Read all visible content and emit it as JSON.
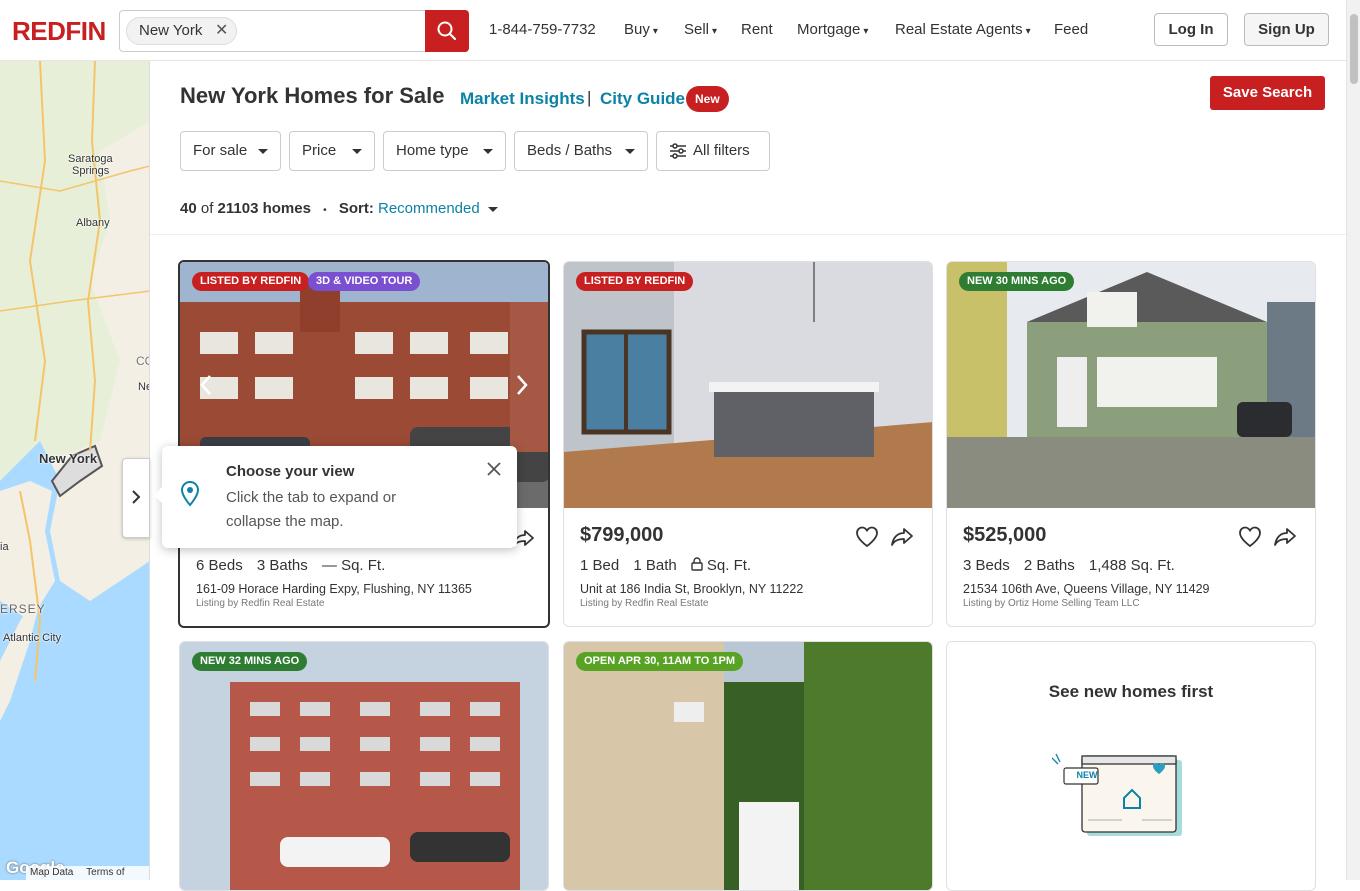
{
  "header": {
    "logo": "REDFIN",
    "search_chip": "New York",
    "phone": "1-844-759-7732",
    "nav": [
      {
        "label": "Buy",
        "caret": "▾"
      },
      {
        "label": "Sell",
        "caret": "▾"
      },
      {
        "label": "Rent",
        "caret": ""
      },
      {
        "label": "Mortgage",
        "caret": "▾"
      },
      {
        "label": "Real Estate Agents",
        "caret": "▾"
      },
      {
        "label": "Feed",
        "caret": ""
      }
    ],
    "login": "Log In",
    "signup": "Sign Up"
  },
  "map": {
    "labels": [
      "Saratoga",
      "Springs",
      "Albany",
      "New York",
      "ERSEY",
      "Atlantic City",
      "Ne",
      "ia",
      "CO"
    ],
    "google": "Google",
    "attribution_data": "Map Data",
    "attribution_terms": "Terms of Use"
  },
  "popover": {
    "title": "Choose your view",
    "body": "Click the tab to expand or collapse the map."
  },
  "page": {
    "title": "New York Homes for Sale",
    "market_insights": "Market Insights",
    "separator": "|",
    "city_guide": "City Guide",
    "new_badge": "New",
    "save_search": "Save Search"
  },
  "filters": [
    "For sale",
    "Price",
    "Home type",
    "Beds / Baths",
    "All filters"
  ],
  "results": {
    "shown": "40",
    "of": "of",
    "total": "21103 homes",
    "dot": "•",
    "sort_label": "Sort:",
    "sort_value": "Recommended"
  },
  "listings": [
    {
      "tags": [
        "LISTED BY REDFIN",
        "3D & VIDEO TOUR"
      ],
      "beds": "6 Beds",
      "baths": "3 Baths",
      "sqft": "— Sq. Ft.",
      "address": "161-09 Horace Harding Expy, Flushing, NY 11365",
      "listing_by": "Listing by Redfin Real Estate"
    },
    {
      "tags": [
        "LISTED BY REDFIN"
      ],
      "price": "$799,000",
      "beds": "1 Bed",
      "baths": "1 Bath",
      "sqft": "Sq. Ft.",
      "address": "Unit at 186 India St, Brooklyn, NY 11222",
      "listing_by": "Listing by Redfin Real Estate"
    },
    {
      "tags": [
        "NEW 30 MINS AGO"
      ],
      "price": "$525,000",
      "beds": "3 Beds",
      "baths": "2 Baths",
      "sqft": "1,488 Sq. Ft.",
      "address": "21534 106th Ave, Queens Village, NY 11429",
      "listing_by": "Listing by Ortiz Home Selling Team LLC"
    },
    {
      "tags": [
        "NEW 32 MINS AGO"
      ]
    },
    {
      "tags": [
        "OPEN APR 30, 11AM TO 1PM"
      ]
    }
  ],
  "promo": {
    "title": "See new homes first",
    "illustration_badge": "NEW"
  },
  "colors": {
    "brand_red": "#c82021",
    "link_blue": "#0c82a6"
  }
}
